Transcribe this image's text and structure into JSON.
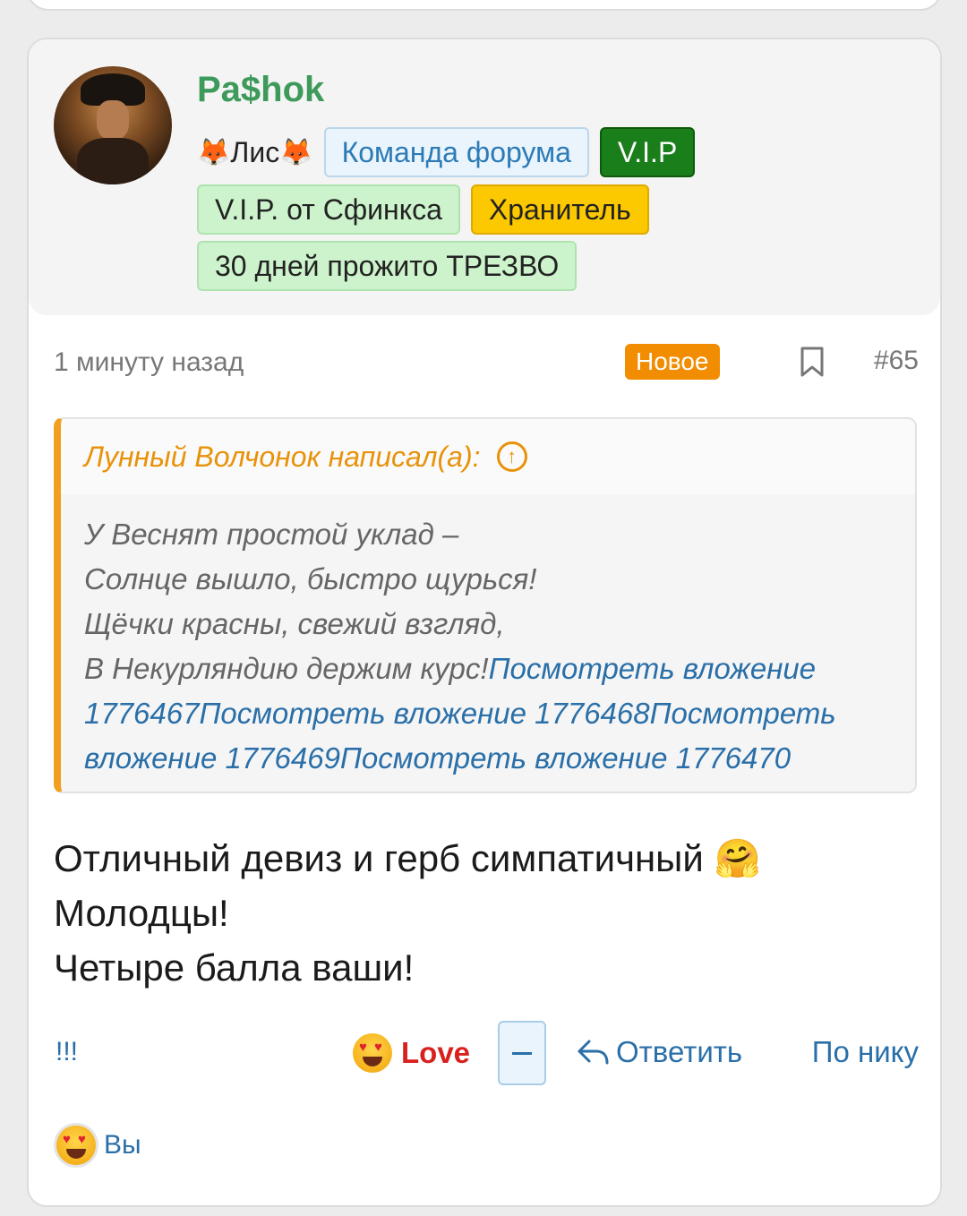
{
  "post": {
    "username": "Pa$hok",
    "role": {
      "prefix_icon": "🦊",
      "label": "Лис",
      "suffix_icon": "🦊"
    },
    "badges_row1": [
      "Команда форума",
      "V.I.P"
    ],
    "badges_row2": [
      "V.I.P. от Сфинкса",
      "Хранитель"
    ],
    "badges_row3": [
      "30 дней прожито ТРЕЗВО"
    ],
    "time": "1 минуту назад",
    "new_label": "Новое",
    "post_number": "#65",
    "quote": {
      "author": "Лунный Волчонок написал(а):",
      "up_icon": "↑",
      "lines": [
        "У Веснят простой уклад –",
        "Солнце вышло, быстро щурься!",
        "Щёчки красны, свежий взгляд,",
        "В Некурляндию держим курс!"
      ],
      "attachments": "Посмотреть вложение 1776467Посмотреть вложение 1776468Посмотреть вложение 1776469Посмотреть вложение 1776470"
    },
    "message_lines": [
      "Отличный девиз и герб симпатичный 🤗",
      "Молодцы!",
      "Четыре балла ваши!"
    ],
    "actions": {
      "exclamations": "!!!",
      "love_label": "Love",
      "reply_label": "Ответить",
      "by_nick_label": "По нику"
    },
    "reactors_label": "Вы",
    "colors": {
      "username": "#3d9a5b",
      "link": "#2a6fa8",
      "quote_accent": "#f0a01e",
      "new_badge": "#f28c00",
      "love": "#d8211f"
    }
  }
}
